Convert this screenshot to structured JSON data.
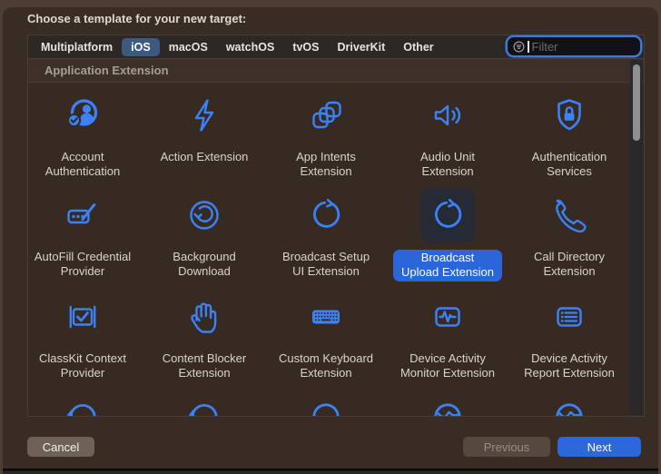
{
  "dialog": {
    "title": "Choose a template for your new target:"
  },
  "tabs": {
    "items": [
      {
        "label": "Multiplatform",
        "selected": false
      },
      {
        "label": "iOS",
        "selected": true
      },
      {
        "label": "macOS",
        "selected": false
      },
      {
        "label": "watchOS",
        "selected": false
      },
      {
        "label": "tvOS",
        "selected": false
      },
      {
        "label": "DriverKit",
        "selected": false
      },
      {
        "label": "Other",
        "selected": false
      }
    ]
  },
  "filter": {
    "placeholder": "Filter"
  },
  "section": {
    "header": "Application Extension"
  },
  "grid": {
    "items": [
      {
        "label": "Account\nAuthentication",
        "icon": "person-check-badge-icon",
        "selected": false
      },
      {
        "label": "Action Extension",
        "icon": "bolt-icon",
        "selected": false
      },
      {
        "label": "App Intents\nExtension",
        "icon": "stacked-squares-icon",
        "selected": false
      },
      {
        "label": "Audio Unit\nExtension",
        "icon": "speaker-waves-icon",
        "selected": false
      },
      {
        "label": "Authentication\nServices",
        "icon": "shield-lock-icon",
        "selected": false
      },
      {
        "label": "AutoFill Credential\nProvider",
        "icon": "credential-pencil-icon",
        "selected": false
      },
      {
        "label": "Background\nDownload",
        "icon": "arrow-down-circle-icon",
        "selected": false
      },
      {
        "label": "Broadcast Setup\nUI Extension",
        "icon": "circular-arrow-icon",
        "selected": false
      },
      {
        "label": "Broadcast\nUpload Extension",
        "icon": "circular-arrow-icon",
        "selected": true
      },
      {
        "label": "Call Directory\nExtension",
        "icon": "phone-icon",
        "selected": false
      },
      {
        "label": "ClassKit Context\nProvider",
        "icon": "board-check-icon",
        "selected": false
      },
      {
        "label": "Content Blocker\nExtension",
        "icon": "hand-raised-icon",
        "selected": false
      },
      {
        "label": "Custom Keyboard\nExtension",
        "icon": "keyboard-icon",
        "selected": false
      },
      {
        "label": "Device Activity\nMonitor Extension",
        "icon": "waveform-rect-icon",
        "selected": false
      },
      {
        "label": "Device Activity\nReport Extension",
        "icon": "list-rect-icon",
        "selected": false
      }
    ]
  },
  "footer": {
    "cancel_label": "Cancel",
    "previous_label": "Previous",
    "next_label": "Next"
  },
  "colors": {
    "icon_blue": "#3b82f7",
    "selection_blue": "#2a66da",
    "tab_selected_blue": "#3d5a7e",
    "focus_ring_blue": "#3c7ad8",
    "sheet_background": "#392c24",
    "window_background": "#4d3d34"
  }
}
